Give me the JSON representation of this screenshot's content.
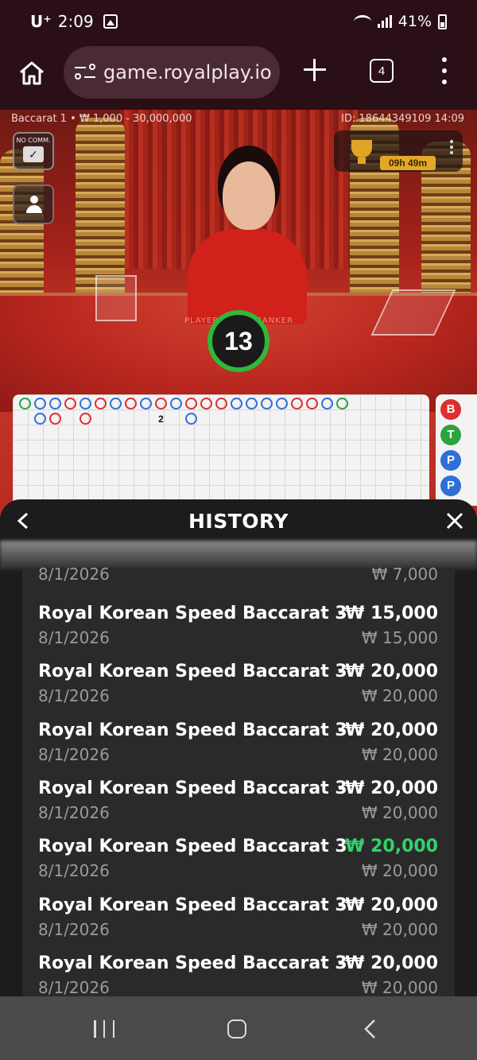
{
  "status_bar": {
    "carrier": "U⁺",
    "time": "2:09",
    "battery": "41%",
    "icons": [
      "image-icon",
      "wifi-icon",
      "signal-icon",
      "battery-icon"
    ]
  },
  "browser": {
    "url": "game.royalplay.io",
    "tab_count": "4",
    "icons": [
      "home-icon",
      "site-settings-icon",
      "new-tab-icon",
      "tab-switcher-icon",
      "more-menu-icon"
    ]
  },
  "game": {
    "table_info": "Baccarat 1 • ₩ 1,000 - 30,000,000",
    "round_id": "ID: 18644349109 14:09",
    "no_comm_label": "NO COMM.",
    "timer": "09h 49m",
    "countdown": "13",
    "table_text_left": "PLAYER",
    "table_text_right": "BANKER",
    "roadmap_marker": "2",
    "side_buttons": [
      {
        "label": "B",
        "color": "#e02d2d"
      },
      {
        "label": "T",
        "color": "#2ca33d"
      },
      {
        "label": "P",
        "color": "#2f6fd6"
      },
      {
        "label": "P",
        "color": "#2f6fd6"
      }
    ]
  },
  "history": {
    "title": "HISTORY",
    "partial_row": {
      "date": "8/1/2026",
      "stake": "₩ 7,000"
    },
    "rows": [
      {
        "game": "Royal Korean Speed Baccarat 3",
        "date": "8/1/2026",
        "amount": "-₩ 15,000",
        "stake": "₩ 15,000",
        "result": "loss"
      },
      {
        "game": "Royal Korean Speed Baccarat 3",
        "date": "8/1/2026",
        "amount": "-₩ 20,000",
        "stake": "₩ 20,000",
        "result": "loss"
      },
      {
        "game": "Royal Korean Speed Baccarat 3",
        "date": "8/1/2026",
        "amount": "-₩ 20,000",
        "stake": "₩ 20,000",
        "result": "loss"
      },
      {
        "game": "Royal Korean Speed Baccarat 3",
        "date": "8/1/2026",
        "amount": "-₩ 20,000",
        "stake": "₩ 20,000",
        "result": "loss"
      },
      {
        "game": "Royal Korean Speed Baccarat 3",
        "date": "8/1/2026",
        "amount": "₩ 20,000",
        "stake": "₩ 20,000",
        "result": "win"
      },
      {
        "game": "Royal Korean Speed Baccarat 3",
        "date": "8/1/2026",
        "amount": "-₩ 20,000",
        "stake": "₩ 20,000",
        "result": "loss"
      },
      {
        "game": "Royal Korean Speed Baccarat 3",
        "date": "8/1/2026",
        "amount": "-₩ 20,000",
        "stake": "₩ 20,000",
        "result": "loss"
      }
    ]
  },
  "colors": {
    "win": "#2fd46a",
    "banker": "#e02d2d",
    "player": "#2f6fd6",
    "tie": "#2ca33d",
    "timer_bg": "#e3a82a",
    "countdown_ring": "#2fb83a"
  }
}
